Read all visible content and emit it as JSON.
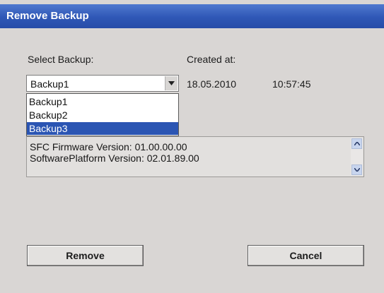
{
  "window": {
    "title": "Remove Backup"
  },
  "select_backup": {
    "label": "Select Backup:",
    "selected": "Backup1",
    "options": [
      "Backup1",
      "Backup2",
      "Backup3"
    ],
    "highlighted_index": 2
  },
  "created": {
    "label": "Created at:",
    "date": "18.05.2010",
    "time": "10:57:45"
  },
  "info": {
    "lines": [
      "SFC Firmware Version: 01.00.00.00",
      "SoftwarePlatform Version: 02.01.89.00"
    ]
  },
  "buttons": {
    "remove": "Remove",
    "cancel": "Cancel"
  },
  "icons": {
    "dropdown": "chevron-down-icon",
    "scroll_up": "scroll-up-icon",
    "scroll_down": "scroll-down-icon"
  },
  "colors": {
    "title_bar": "#2f57b6",
    "selection": "#2b55b3",
    "dialog_bg": "#d9d6d4"
  }
}
